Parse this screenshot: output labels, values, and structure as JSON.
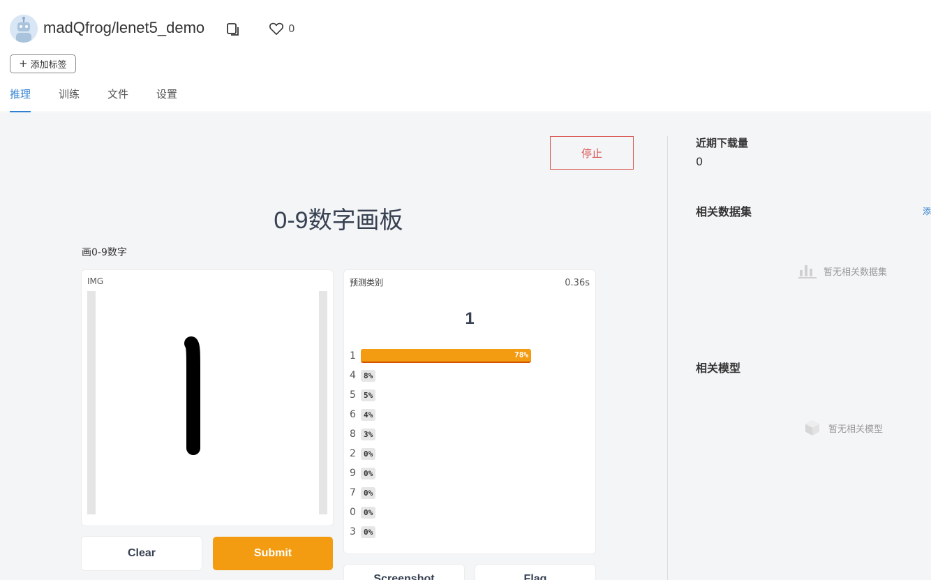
{
  "header": {
    "owner": "madQfrog",
    "separator": "/",
    "repo": "lenet5_demo",
    "like_count": "0",
    "add_tag_label": "添加标签"
  },
  "tabs": [
    {
      "label": "推理",
      "active": true
    },
    {
      "label": "训练",
      "active": false
    },
    {
      "label": "文件",
      "active": false
    },
    {
      "label": "设置",
      "active": false
    }
  ],
  "app": {
    "stop_label": "停止",
    "title": "0-9数字画板",
    "description": "画0-9数字",
    "img_label": "IMG"
  },
  "prediction": {
    "label": "预测类别",
    "time": "0.36s",
    "top_class": "1",
    "rows": [
      {
        "cls": "1",
        "pct": "78%",
        "value": 0.78
      },
      {
        "cls": "4",
        "pct": "8%",
        "value": 0.08
      },
      {
        "cls": "5",
        "pct": "5%",
        "value": 0.05
      },
      {
        "cls": "6",
        "pct": "4%",
        "value": 0.04
      },
      {
        "cls": "8",
        "pct": "3%",
        "value": 0.03
      },
      {
        "cls": "2",
        "pct": "0%",
        "value": 0.0
      },
      {
        "cls": "9",
        "pct": "0%",
        "value": 0.0
      },
      {
        "cls": "7",
        "pct": "0%",
        "value": 0.0
      },
      {
        "cls": "0",
        "pct": "0%",
        "value": 0.0
      },
      {
        "cls": "3",
        "pct": "0%",
        "value": 0.0
      }
    ]
  },
  "buttons": {
    "clear": "Clear",
    "submit": "Submit",
    "screenshot": "Screenshot",
    "flag": "Flag"
  },
  "sidebar": {
    "downloads_heading": "近期下载量",
    "downloads_value": "0",
    "datasets_heading": "相关数据集",
    "datasets_add": "添",
    "datasets_empty": "暂无相关数据集",
    "models_heading": "相关模型",
    "models_empty": "暂无相关模型"
  },
  "colors": {
    "accent": "#2f80d1",
    "submit": "#f39c12",
    "stop": "#d9534f",
    "background": "#f4f5f7"
  }
}
